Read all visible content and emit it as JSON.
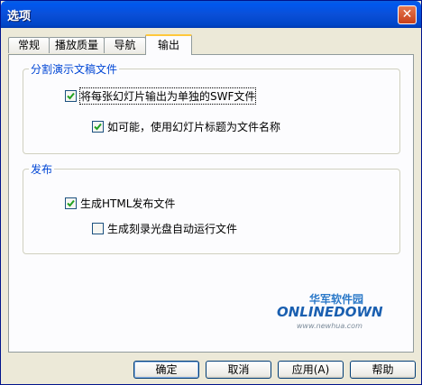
{
  "window": {
    "title": "选项",
    "close_glyph": "✕"
  },
  "tabs": [
    {
      "label": "常规"
    },
    {
      "label": "播放质量"
    },
    {
      "label": "导航"
    },
    {
      "label": "输出",
      "active": true
    }
  ],
  "group_split": {
    "label": "分割演示文稿文件",
    "options": [
      {
        "label": "将每张幻灯片输出为单独的SWF文件",
        "checked": true
      },
      {
        "label": "如可能，使用幻灯片标题为文件名称",
        "checked": true
      }
    ]
  },
  "group_publish": {
    "label": "发布",
    "options": [
      {
        "label": "生成HTML发布文件",
        "checked": true
      },
      {
        "label": "生成刻录光盘自动运行文件",
        "checked": false
      }
    ]
  },
  "watermark": {
    "cn": "华军软件园",
    "en": "ONLINEDOWN",
    "url": "www.newhua.com"
  },
  "buttons": {
    "ok": "确定",
    "cancel": "取消",
    "apply": "应用(A)",
    "help": "帮助"
  },
  "colors": {
    "title_bar": "#0a4fd8",
    "group_label": "#0046d5",
    "dialog_bg": "#ece9d8"
  }
}
